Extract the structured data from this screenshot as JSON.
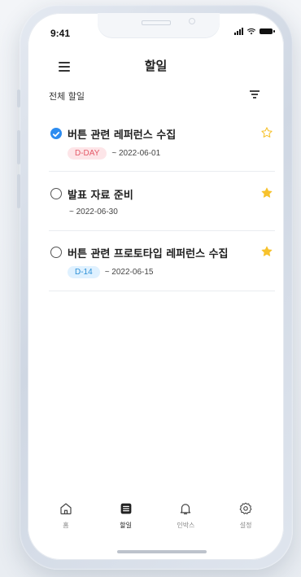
{
  "status_bar": {
    "time": "9:41"
  },
  "header": {
    "title": "할일"
  },
  "list": {
    "section_label": "전체 할일"
  },
  "tasks": [
    {
      "title": "버튼 관련 레퍼런스 수집",
      "done": true,
      "starred": false,
      "badge": "D-DAY",
      "badge_color": "red",
      "due": "~  2022-06-01"
    },
    {
      "title": "발표 자료 준비",
      "done": false,
      "starred": true,
      "badge": "",
      "badge_color": "",
      "due": "~  2022-06-30"
    },
    {
      "title": "버튼 관련 프로토타입 레퍼런스 수집",
      "done": false,
      "starred": true,
      "badge": "D-14",
      "badge_color": "blue",
      "due": "~  2022-06-15"
    }
  ],
  "tabbar": {
    "tabs": [
      {
        "label": "홈",
        "icon": "home-icon",
        "active": false
      },
      {
        "label": "할일",
        "icon": "list-icon",
        "active": true
      },
      {
        "label": "인박스",
        "icon": "bell-icon",
        "active": false
      },
      {
        "label": "설정",
        "icon": "gear-icon",
        "active": false
      }
    ]
  },
  "colors": {
    "accent": "#2d8cf0",
    "star": "#f7c22d",
    "dday_bg": "#fde5e8",
    "dday_text": "#e45a68",
    "d14_bg": "#dff1ff",
    "d14_text": "#2b8fd6"
  }
}
